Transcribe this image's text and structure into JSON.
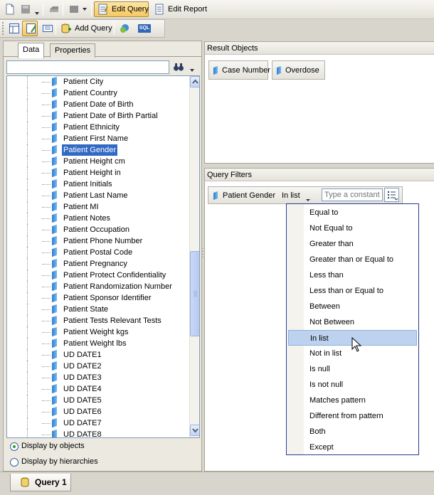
{
  "toolbar": {
    "edit_query_label": "Edit Query",
    "edit_report_label": "Edit Report",
    "add_query_label": "Add Query",
    "sql_label": "SQL"
  },
  "left_panel": {
    "tabs": [
      {
        "label": "Data",
        "active": true
      },
      {
        "label": "Properties",
        "active": false
      }
    ],
    "search_value": "",
    "tree_items": [
      {
        "label": "Patient City"
      },
      {
        "label": "Patient Country"
      },
      {
        "label": "Patient Date of Birth"
      },
      {
        "label": "Patient Date of Birth Partial"
      },
      {
        "label": "Patient Ethnicity"
      },
      {
        "label": "Patient First Name"
      },
      {
        "label": "Patient Gender",
        "selected": true
      },
      {
        "label": "Patient Height cm"
      },
      {
        "label": "Patient Height in"
      },
      {
        "label": "Patient Initials"
      },
      {
        "label": "Patient Last Name"
      },
      {
        "label": "Patient MI"
      },
      {
        "label": "Patient Notes"
      },
      {
        "label": "Patient Occupation"
      },
      {
        "label": "Patient Phone Number"
      },
      {
        "label": "Patient Postal Code"
      },
      {
        "label": "Patient Pregnancy"
      },
      {
        "label": "Patient Protect Confidentiality"
      },
      {
        "label": "Patient Randomization Number"
      },
      {
        "label": "Patient Sponsor Identifier"
      },
      {
        "label": "Patient State"
      },
      {
        "label": "Patient Tests Relevant Tests"
      },
      {
        "label": "Patient Weight kgs"
      },
      {
        "label": "Patient Weight lbs"
      },
      {
        "label": "UD DATE1"
      },
      {
        "label": "UD DATE2"
      },
      {
        "label": "UD DATE3"
      },
      {
        "label": "UD DATE4"
      },
      {
        "label": "UD DATE5"
      },
      {
        "label": "UD DATE6"
      },
      {
        "label": "UD DATE7"
      },
      {
        "label": "UD DATE8"
      }
    ],
    "display_options": [
      {
        "label": "Display by objects",
        "checked": true
      },
      {
        "label": "Display by hierarchies",
        "checked": false
      }
    ]
  },
  "result_objects": {
    "title": "Result Objects",
    "items": [
      "Case Number",
      "Overdose"
    ]
  },
  "query_filters": {
    "title": "Query Filters",
    "filter": {
      "object": "Patient Gender",
      "operator": "In list",
      "constant_placeholder": "Type a constant"
    },
    "operators": [
      "Equal to",
      "Not Equal to",
      "Greater than",
      "Greater than or Equal to",
      "Less than",
      "Less than or Equal to",
      "Between",
      "Not Between",
      "In list",
      "Not in list",
      "Is null",
      "Is not null",
      "Matches pattern",
      "Different from pattern",
      "Both",
      "Except"
    ],
    "highlighted_operator": "In list"
  },
  "bottom_tab": {
    "label": "Query 1"
  }
}
